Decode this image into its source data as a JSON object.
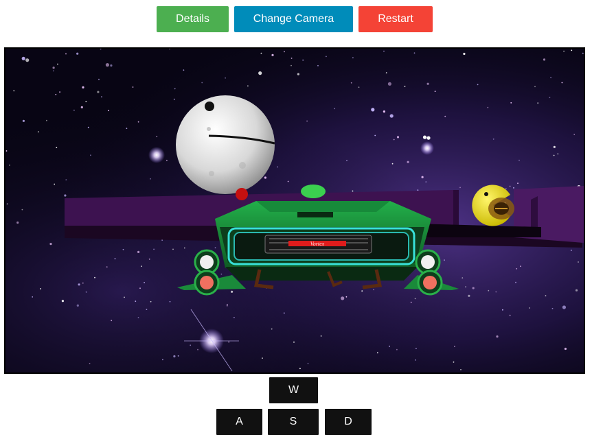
{
  "toolbar": {
    "details_label": "Details",
    "camera_label": "Change Camera",
    "restart_label": "Restart",
    "details_color": "#4caf50",
    "camera_color": "#008cba",
    "restart_color": "#f44336"
  },
  "scene": {
    "ship_badge_text": "Vortex",
    "background_color": "#080514",
    "track_color": "#3d1250",
    "ship_color": "#1a8a3a",
    "ship_glow_color": "#38e0d8",
    "pacman_color": "#f2e21a",
    "moon_color": "#e6e6e6"
  },
  "controls": {
    "up_key": "W",
    "left_key": "A",
    "down_key": "S",
    "right_key": "D"
  }
}
